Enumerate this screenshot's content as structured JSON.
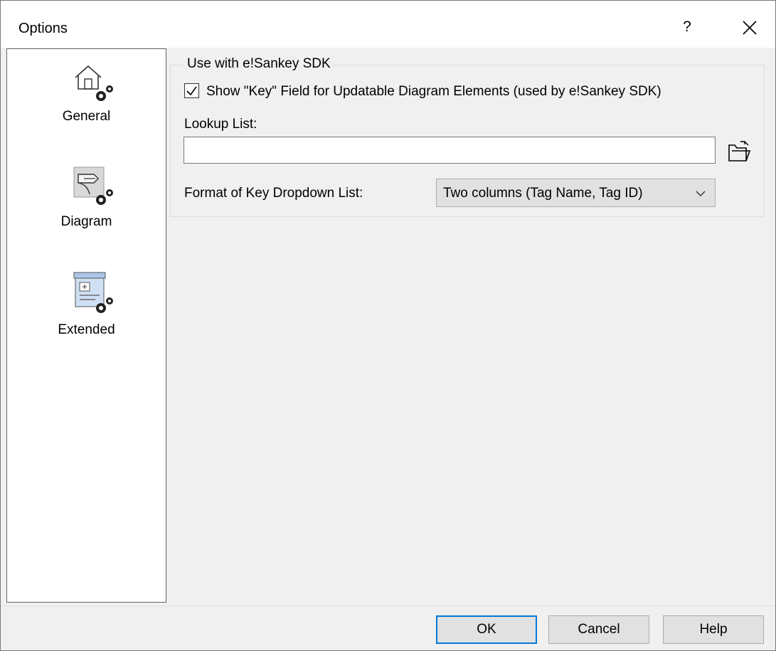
{
  "window": {
    "title": "Options",
    "help_label": "?",
    "close_icon": "close-icon"
  },
  "sidebar": {
    "items": [
      {
        "label": "General",
        "icon": "house-gear-icon",
        "active": false
      },
      {
        "label": "Diagram",
        "icon": "diagram-gear-icon",
        "active": false
      },
      {
        "label": "Extended",
        "icon": "extended-gear-icon",
        "active": true
      }
    ]
  },
  "group": {
    "legend": "Use with e!Sankey SDK",
    "checkbox_label": "Show \"Key\" Field for Updatable Diagram Elements (used by e!Sankey SDK)",
    "checkbox_checked": true,
    "lookup_label": "Lookup List:",
    "lookup_value": "",
    "browse_icon": "open-folder-icon",
    "format_label": "Format of Key Dropdown List:",
    "format_value": "Two columns (Tag Name, Tag ID)"
  },
  "buttons": {
    "ok": "OK",
    "cancel": "Cancel",
    "help": "Help"
  },
  "colors": {
    "default_button_border": "#0078d7",
    "dialog_background": "#f0f0f0"
  }
}
